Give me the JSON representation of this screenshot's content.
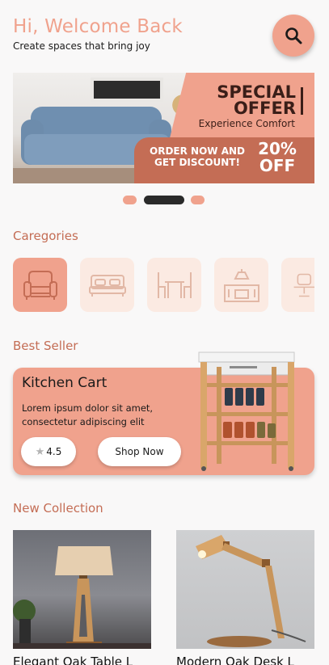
{
  "header": {
    "title": "Hi, Welcome Back",
    "subtitle": "Create spaces that bring joy",
    "search_icon": "search-icon"
  },
  "banner": {
    "headline_line1": "SPECIAL",
    "headline_line2": "OFFER",
    "tagline": "Experience Comfort",
    "cta_line1": "ORDER NOW AND",
    "cta_line2": "GET DISCOUNT!",
    "discount_value": "20%",
    "discount_label": "OFF",
    "slides_total": 3,
    "active_slide": 2
  },
  "categories": {
    "title": "Caregories",
    "items": [
      {
        "icon": "armchair-icon",
        "active": true
      },
      {
        "icon": "bed-icon",
        "active": false
      },
      {
        "icon": "dining-table-icon",
        "active": false
      },
      {
        "icon": "kitchen-icon",
        "active": false
      },
      {
        "icon": "desk-chair-icon",
        "active": false
      }
    ]
  },
  "best_seller": {
    "title": "Best Seller",
    "product_name": "Kitchen Cart",
    "description": "Lorem ipsum dolor sit amet, consectetur adipiscing elit",
    "rating": "4.5",
    "button_label": "Shop Now"
  },
  "new_collection": {
    "title": "New Collection",
    "items": [
      {
        "name": "Elegant Oak Table L"
      },
      {
        "name": "Modern Oak Desk L"
      }
    ]
  },
  "colors": {
    "accent": "#f0a28d",
    "accent_dark": "#c46d55",
    "category_bg": "#fbeae2"
  }
}
